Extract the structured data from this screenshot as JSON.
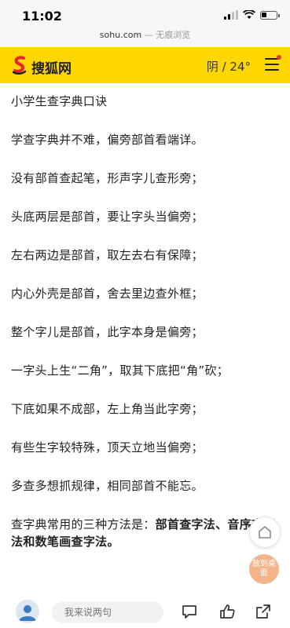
{
  "status": {
    "time": "11:02"
  },
  "url_bar": {
    "domain": "sohu.com",
    "separator": " — ",
    "mode": "无痕浏览"
  },
  "header": {
    "site_name": "搜狐网",
    "weather": "阴 / 24°"
  },
  "article": {
    "title": "小学生查字典口诀",
    "lines": [
      "学查字典并不难，偏旁部首看端详。",
      "没有部首查起笔，形声字儿查形旁；",
      "头底两层是部首，要让字头当偏旁；",
      "左右两边是部首，取左去右有保障；",
      "内心外壳是部首，舍去里边查外框；",
      "整个字儿是部首，此字本身是偏旁；",
      "一字头上生“二角”，取其下底把“角”砍；",
      "下底如果不成部，左上角当此字旁；",
      "有些生字较特殊，顶天立地当偏旁；",
      "多查多想抓规律，相同部首不能忘。"
    ],
    "methods_intro": "查字典常用的三种方法是：",
    "method_1": "部首查字法",
    "method_2": "、音序查字法",
    "method_and": "和",
    "method_3": "数笔画查字法",
    "methods_end": "。"
  },
  "floating": {
    "desktop_label": "放到桌面"
  },
  "bottom_bar": {
    "comment_placeholder": "我来说两句"
  },
  "colors": {
    "brand_yellow": "#ffd700",
    "notification_red": "#e53935"
  },
  "icons": [
    "signal-icon",
    "wifi-icon",
    "battery-icon",
    "sohu-logo-icon",
    "menu-icon",
    "home-icon",
    "comment-icon",
    "like-icon",
    "share-icon"
  ]
}
